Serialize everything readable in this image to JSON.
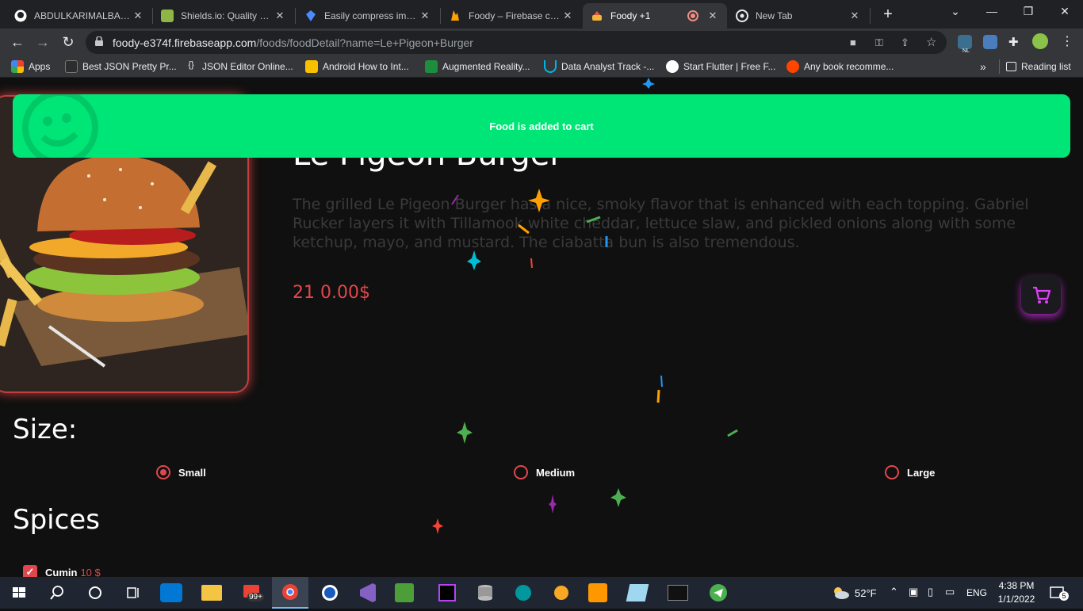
{
  "browser": {
    "tabs": [
      {
        "label": "ABDULKARIMALBAIK/",
        "icon": "github-icon"
      },
      {
        "label": "Shields.io: Quality met",
        "icon": "shields-icon"
      },
      {
        "label": "Easily compress image",
        "icon": "compress-icon"
      },
      {
        "label": "Foody – Firebase cons",
        "icon": "firebase-icon"
      },
      {
        "label": "Foody +1",
        "icon": "foody-icon",
        "active": true
      },
      {
        "label": "New Tab",
        "icon": "chrome-icon"
      }
    ],
    "url_host": "foody-e374f.firebaseapp.com",
    "url_path": "/foods/foodDetail?name=Le+Pigeon+Burger",
    "bookmarks": [
      {
        "label": "Apps",
        "icon": "apps-grid-icon"
      },
      {
        "label": "Best JSON Pretty Pr...",
        "icon": "jf-icon"
      },
      {
        "label": "JSON Editor Online...",
        "icon": "braces-icon"
      },
      {
        "label": "Android How to Int...",
        "icon": "android-icon"
      },
      {
        "label": "Augmented Reality...",
        "icon": "ar-icon"
      },
      {
        "label": "Data Analyst Track -...",
        "icon": "udacity-icon"
      },
      {
        "label": "Start Flutter | Free F...",
        "icon": "globe-icon"
      },
      {
        "label": "Any book recomme...",
        "icon": "reddit-icon"
      }
    ],
    "more_bookmarks": "»",
    "reading_list": "Reading list",
    "ext_badge": "NL"
  },
  "food": {
    "title": "Le Pigeon Burger",
    "description": "The grilled Le Pigeon Burger has a nice, smoky flavor that is enhanced with each topping. Gabriel Rucker layers it with Tillamook white cheddar, lettuce slaw, and pickled onions along with some ketchup, mayo, and mustard. The ciabatta bun is also tremendous.",
    "price": "21 0.00$"
  },
  "size": {
    "title": "Size:",
    "options": [
      {
        "label": "Small",
        "selected": true
      },
      {
        "label": "Medium",
        "selected": false
      },
      {
        "label": "Large",
        "selected": false
      }
    ]
  },
  "spices": {
    "title": "Spices",
    "items": [
      {
        "label": "Cumin",
        "price": "10 $",
        "checked": true
      }
    ]
  },
  "toast": {
    "message": "Food is added to cart",
    "color": "#00e676"
  },
  "taskbar": {
    "weather": "52°F",
    "lang": "ENG",
    "time": "4:38 PM",
    "date": "1/1/2022",
    "notifications": "5",
    "gmail_badge": "99+"
  },
  "colors": {
    "accent": "#e0474c",
    "cart_glow": "#c828dc"
  }
}
